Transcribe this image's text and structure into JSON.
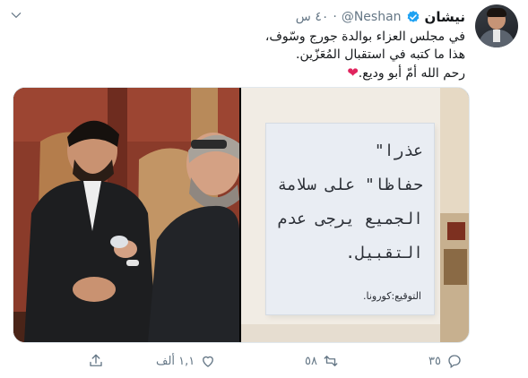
{
  "tweet": {
    "display_name": "نيشان",
    "handle": "@Neshan",
    "separator": "·",
    "time": "٤٠ س",
    "lines": [
      "في مجلس العزاء بوالدة جورج وسّوف،",
      "هذا ما كتبه في استقبال المُعَزّين.",
      "رحم الله أمّ أبو وديع."
    ],
    "heart": "❤"
  },
  "notice": {
    "lines": [
      "عذرا\"",
      "حفاظا\" على سلامة",
      "الجميع يرجى عدم",
      "التقبيل."
    ],
    "signature": "التوقيع:كورونا."
  },
  "actions": {
    "reply_count": "٣٥",
    "retweet_count": "٥٨",
    "like_count": "١,١ ألف"
  },
  "colors": {
    "verified": "#1da1f2",
    "like_heart": "#e0245e",
    "secondary_text": "#657786"
  }
}
